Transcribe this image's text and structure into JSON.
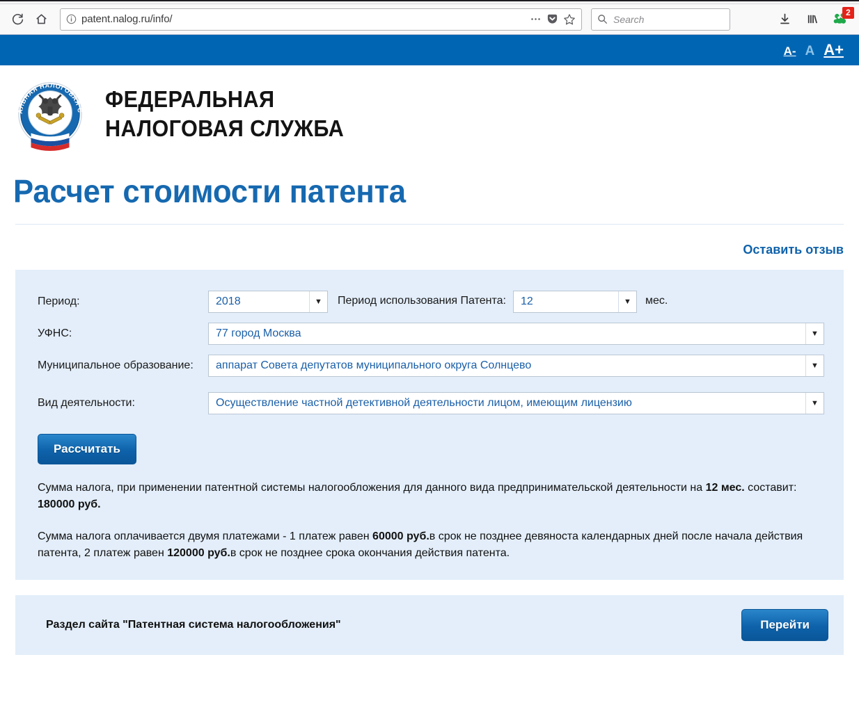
{
  "browser": {
    "reload_icon": "reload-icon",
    "home_icon": "home-icon",
    "identity_icon": "info-circle-icon",
    "url": "patent.nalog.ru/info/",
    "url_host": "nalog.ru",
    "url_prefix": "patent.",
    "url_suffix": "/info/",
    "page_actions_icon": "ellipsis-icon",
    "pocket_icon": "pocket-icon",
    "bookmark_icon": "star-icon",
    "search_placeholder": "Search",
    "search_icon": "search-icon",
    "downloads_icon": "downloads-icon",
    "library_icon": "library-icon",
    "extension_icon": "extension-icon",
    "extension_badge": "2"
  },
  "site_header": {
    "font_size_controls": [
      {
        "label": "A-",
        "name": "font-size-decrease"
      },
      {
        "label": "A",
        "name": "font-size-default"
      },
      {
        "label": "A+",
        "name": "font-size-increase"
      }
    ],
    "brand_line1": "ФЕДЕРАЛЬНАЯ",
    "brand_line2": "НАЛОГОВАЯ СЛУЖБА",
    "emblem_name": "fns-emblem"
  },
  "page": {
    "title": "Расчет стоимости патента",
    "feedback_link": "Оставить отзыв"
  },
  "form": {
    "period_label": "Период:",
    "period_value": "2018",
    "usage_label": "Период использования Патента:",
    "usage_value": "12",
    "usage_unit": "мес.",
    "ufns_label": "УФНС:",
    "ufns_value": "77 город Москва",
    "municipal_label": "Муниципальное образование:",
    "municipal_value": "аппарат Совета депутатов муниципального округа Солнцево",
    "activity_label": "Вид деятельности:",
    "activity_value": "Осуществление частной детективной деятельности лицом, имеющим лицензию",
    "calculate_button": "Рассчитать",
    "dropdown_arrow_icon": "chevron-down-icon"
  },
  "result": {
    "p1_part1": "Сумма налога, при применении патентной системы налогообложения для данного вида предпринимательской деятельности на ",
    "p1_bold1": "12 мес.",
    "p1_part2": " составит: ",
    "p1_bold2": "180000 руб.",
    "p2_part1": "Сумма налога оплачивается двумя платежами - 1 платеж равен ",
    "p2_bold1": "60000 руб.",
    "p2_part2": "в срок не позднее девяноста календарных дней после начала действия патента, 2 платеж равен ",
    "p2_bold2": "120000 руб.",
    "p2_part3": "в срок не позднее срока окончания действия патента."
  },
  "footer": {
    "section_text": "Раздел сайта \"Патентная система налогообложения\"",
    "goto_button": "Перейти"
  },
  "colors": {
    "header_blue": "#0066b3",
    "panel_blue": "#e3eefa",
    "title_blue": "#1669b0",
    "link_blue": "#0f62ab",
    "badge_red": "#e4221a"
  }
}
